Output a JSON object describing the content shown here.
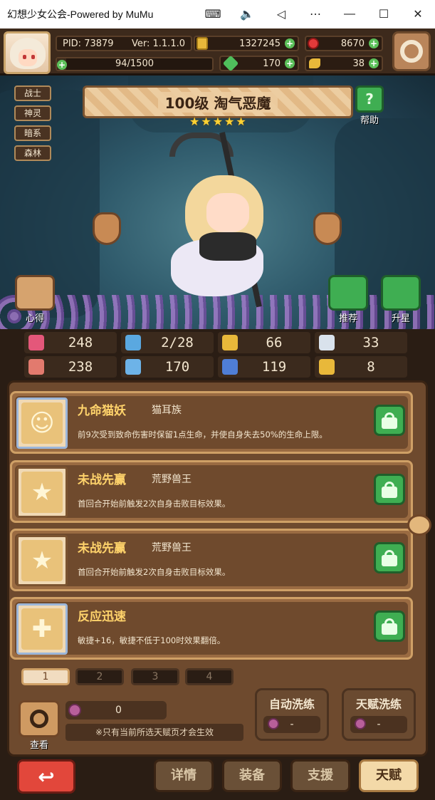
{
  "window": {
    "title": "幻想少女公会-Powered by MuMu"
  },
  "header": {
    "pid": "PID: 73879",
    "version": "Ver: 1.1.1.0",
    "gold": "1327245",
    "gems": "8670",
    "exp_text": "94/1500",
    "clover": "170",
    "keys": "38"
  },
  "character": {
    "title": "100级 淘气恶魔",
    "stars": 5,
    "tags": [
      "战士",
      "神灵",
      "暗系",
      "森林"
    ],
    "help_label": "帮助",
    "insight_label": "心得",
    "recommend_label": "推荐",
    "upgrade_label": "升星"
  },
  "stats": {
    "hp": "248",
    "water": "2/28",
    "shield": "66",
    "wing": "33",
    "attack": "238",
    "book": "170",
    "speed": "119",
    "luck": "8"
  },
  "talents": [
    {
      "name": "九命猫妖",
      "sub": "猫耳族",
      "desc": "前9次受到致命伤害时保留1点生命，并使自身失去50%的生命上限。"
    },
    {
      "name": "未战先赢",
      "sub": "荒野兽王",
      "desc": "首回合开始前触发2次自身击败目标效果。"
    },
    {
      "name": "未战先赢",
      "sub": "荒野兽王",
      "desc": "首回合开始前触发2次自身击败目标效果。"
    },
    {
      "name": "反应迅速",
      "sub": "",
      "desc": "敏捷+16，敏捷不低于100时效果翻倍。"
    }
  ],
  "pages": [
    "1",
    "2",
    "3",
    "4"
  ],
  "bottom": {
    "inspect_label": "查看",
    "material_count": "0",
    "note": "※只有当前所选天赋页才会生效",
    "auto_wash_label": "自动洗练",
    "auto_wash_cost": "-",
    "talent_wash_label": "天赋洗练",
    "talent_wash_cost": "-"
  },
  "nav": {
    "details": "详情",
    "equipment": "装备",
    "support": "支援",
    "talent": "天赋"
  },
  "colors": {
    "accent_gold": "#ffd36b",
    "lock_green": "#3fae52",
    "back_red": "#e2473b"
  }
}
